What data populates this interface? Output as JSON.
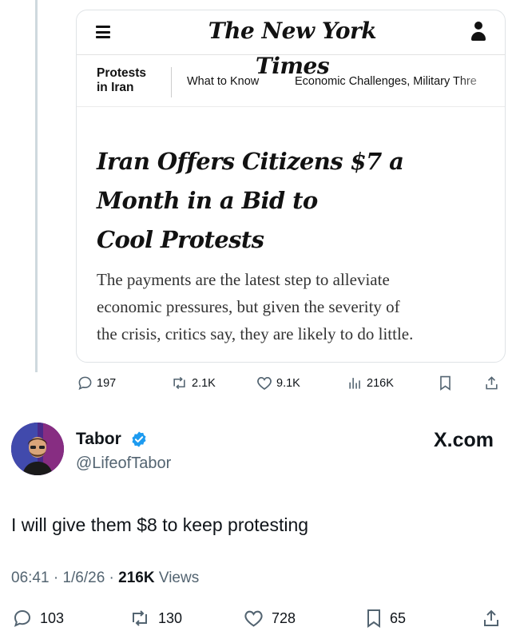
{
  "quoted_post": {
    "site_logo": "The New York Times",
    "section_label_line1": "Protests",
    "section_label_line2": "in Iran",
    "nav_links": [
      "What to Know",
      "Economic Challenges, Military Thre"
    ],
    "headline_line1": "Iran Offers Citizens $7 a",
    "headline_line2": "Month in a Bid to",
    "headline_line3": "Cool Protests",
    "summary_line1": "The payments are the latest step to alleviate",
    "summary_line2": "economic pressures, but given the severity of",
    "summary_line3": "the crisis, critics say, they are likely to do little.",
    "stats": {
      "replies": "197",
      "reposts": "2.1K",
      "likes": "9.1K",
      "views": "216K"
    }
  },
  "author": {
    "display_name": "Tabor",
    "handle": "@LifeofTabor",
    "verified": true
  },
  "site": "X.com",
  "post": {
    "text": "I will give them $8 to keep protesting",
    "time": "06:41",
    "date": "1/6/26",
    "views_count": "216K",
    "views_label": "Views",
    "separator": "·"
  },
  "actions": {
    "replies": "103",
    "reposts": "130",
    "likes": "728",
    "bookmarks": "65"
  },
  "colors": {
    "text": "#0f1419",
    "muted": "#536471",
    "verified": "#1d9bf0",
    "thread_line": "#cfd9de"
  },
  "icons": [
    "menu-icon",
    "account-icon",
    "reply-icon",
    "repost-icon",
    "like-icon",
    "views-icon",
    "bookmark-icon",
    "share-icon",
    "verified-badge-icon"
  ]
}
